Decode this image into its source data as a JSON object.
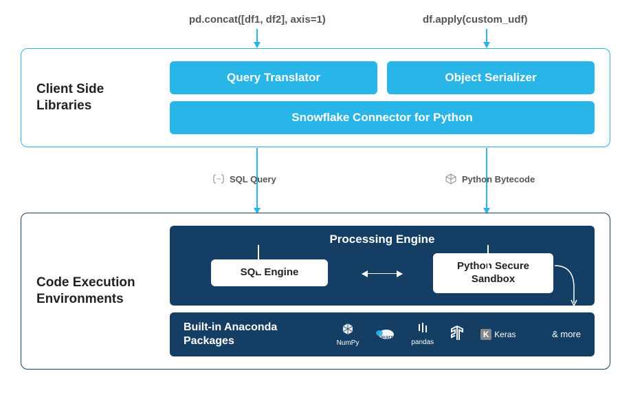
{
  "top_labels": {
    "left": "pd.concat([df1, df2], axis=1)",
    "right": "df.apply(custom_udf)"
  },
  "client_section": {
    "title": "Client Side Libraries",
    "query_translator": "Query Translator",
    "object_serializer": "Object Serializer",
    "connector": "Snowflake Connector for Python"
  },
  "mid_labels": {
    "sql_query": "SQL Query",
    "bytecode": "Python Bytecode"
  },
  "exec_section": {
    "title": "Code Execution Environments",
    "processing_title": "Processing Engine",
    "sql_engine": "SQL Engine",
    "python_sandbox": "Python Secure Sandbox",
    "anaconda_label": "Built-in Anaconda Packages",
    "logos": {
      "numpy": "NumPy",
      "sklearn": "learn",
      "pandas": "pandas",
      "tensorflow": "",
      "keras": "Keras"
    },
    "more": "& more"
  }
}
